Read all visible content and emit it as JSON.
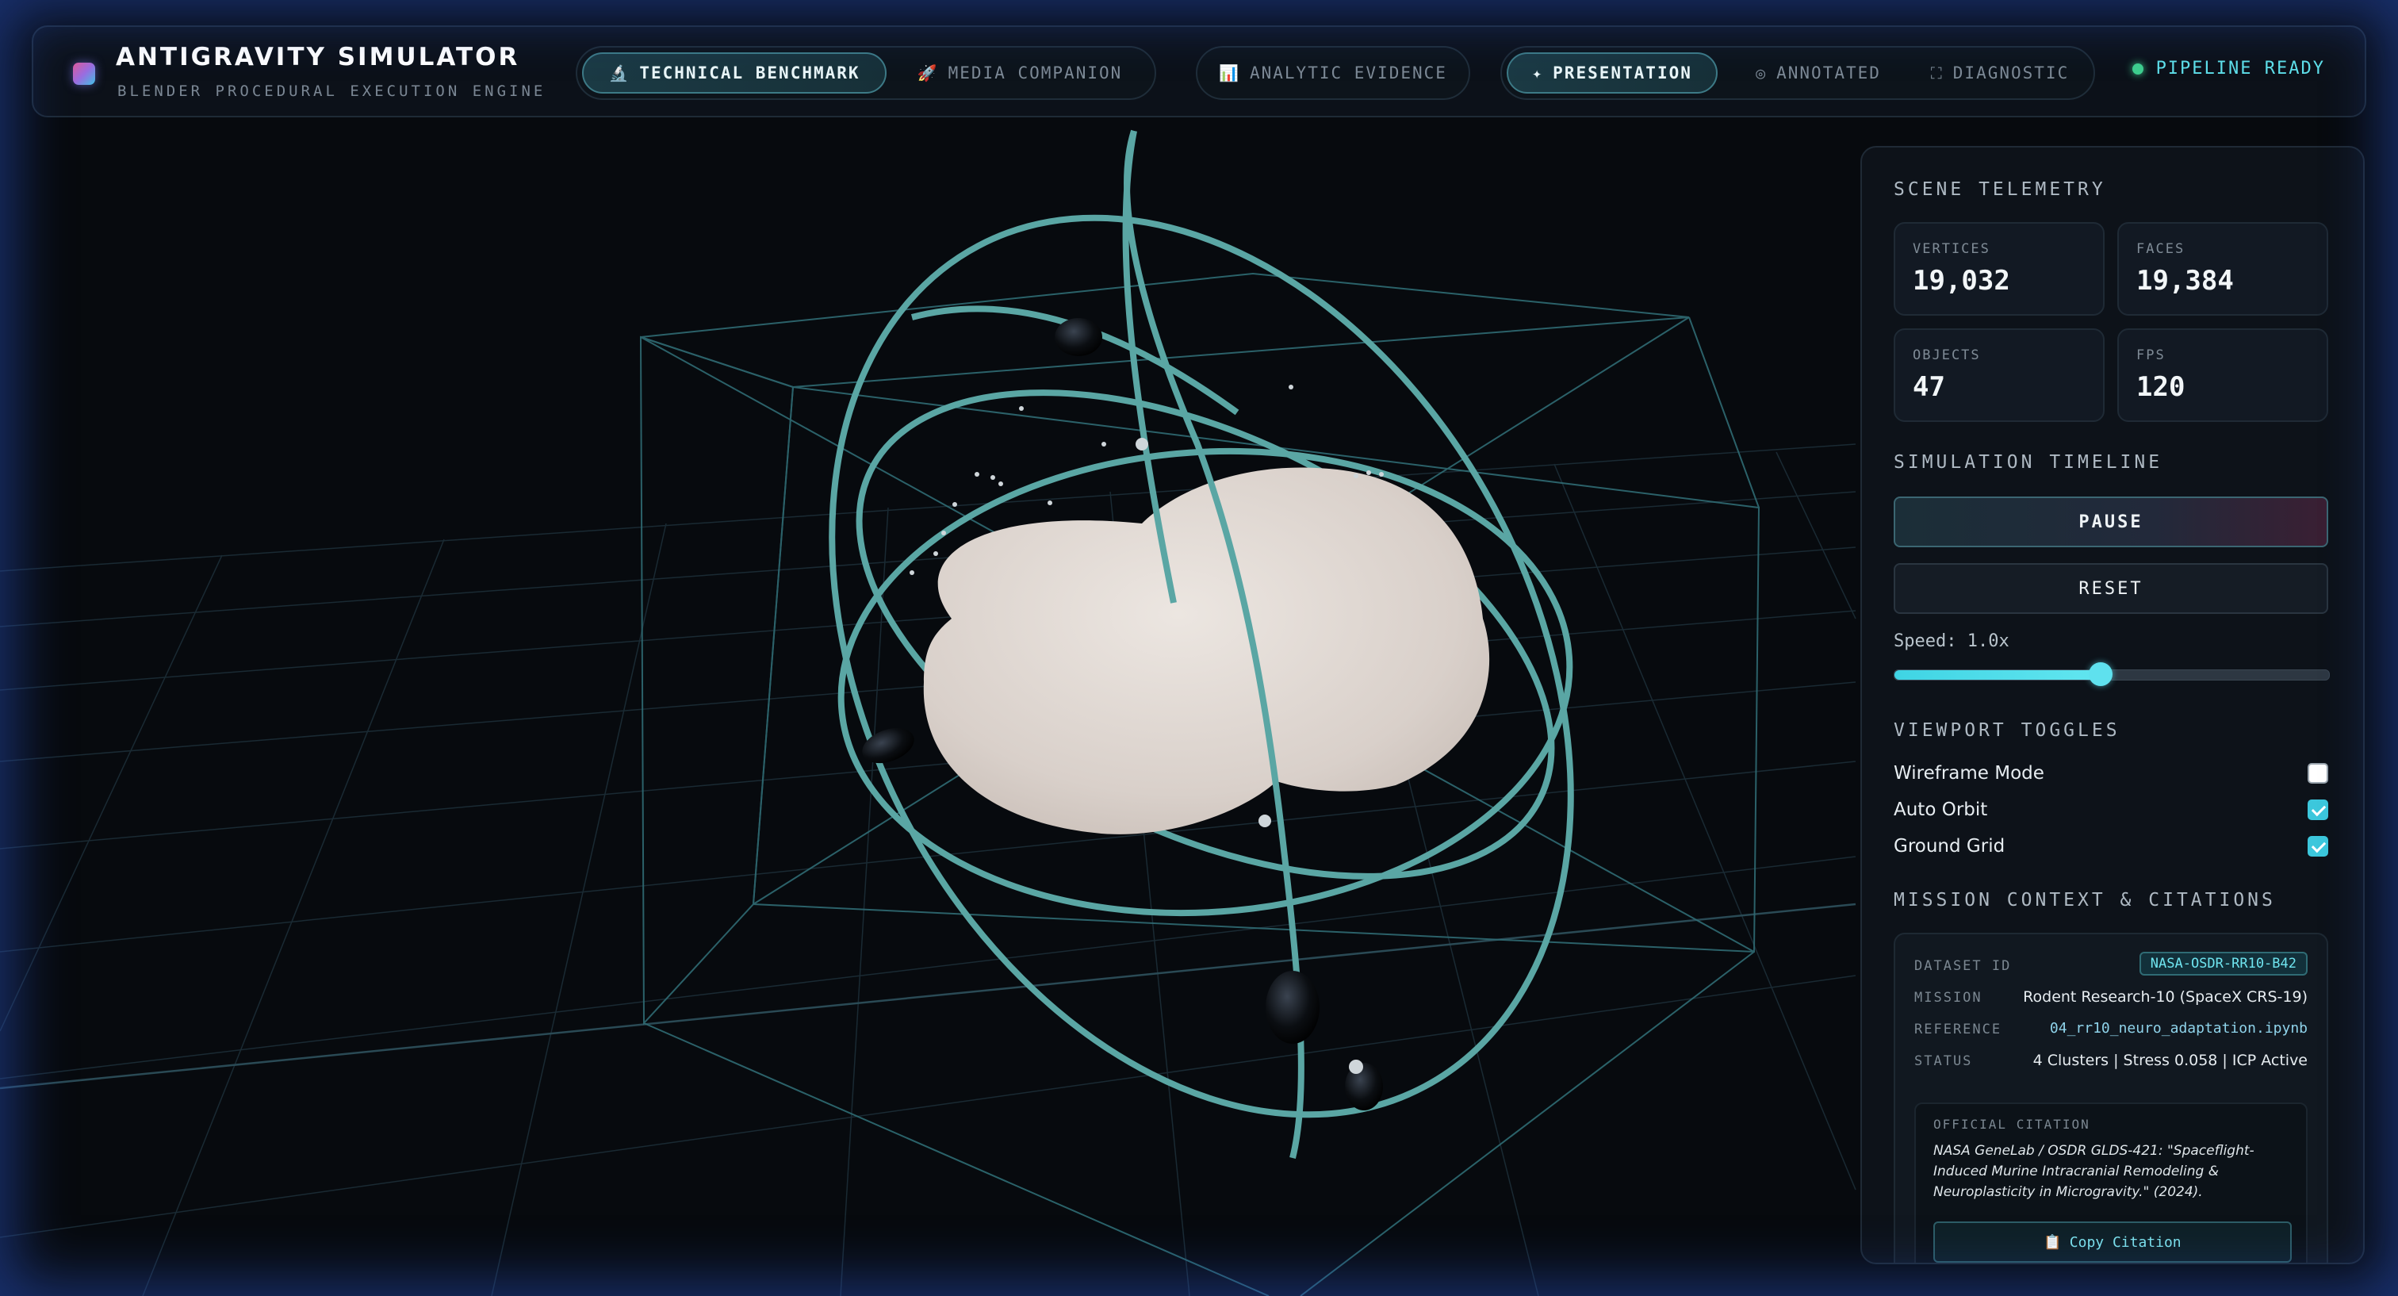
{
  "app": {
    "title": "ANTIGRAVITY SIMULATOR",
    "subtitle": "BLENDER PROCEDURAL EXECUTION ENGINE"
  },
  "nav": {
    "group1": [
      {
        "icon": "microscope-icon",
        "glyph": "🔬",
        "label": "TECHNICAL BENCHMARK",
        "active": true
      },
      {
        "icon": "rocket-icon",
        "glyph": "🚀",
        "label": "MEDIA COMPANION",
        "active": false
      }
    ],
    "group2": [
      {
        "icon": "bar-chart-icon",
        "glyph": "📊",
        "label": "ANALYTIC EVIDENCE",
        "active": false
      }
    ],
    "group3": [
      {
        "icon": "sparkle-icon",
        "glyph": "✦",
        "label": "PRESENTATION",
        "active": true
      },
      {
        "icon": "target-icon",
        "glyph": "◎",
        "label": "ANNOTATED",
        "active": false
      },
      {
        "icon": "frame-icon",
        "glyph": "⛶",
        "label": "DIAGNOSTIC",
        "active": false
      }
    ]
  },
  "status": {
    "label": "PIPELINE READY",
    "color": "#3ecf8e"
  },
  "telemetry": {
    "title": "SCENE TELEMETRY",
    "vertices_label": "VERTICES",
    "vertices": "19,032",
    "faces_label": "FACES",
    "faces": "19,384",
    "objects_label": "OBJECTS",
    "objects": "47",
    "fps_label": "FPS",
    "fps": "120"
  },
  "timeline": {
    "title": "SIMULATION TIMELINE",
    "pause_label": "PAUSE",
    "reset_label": "RESET",
    "speed_label": "Speed: 1.0x",
    "speed_fraction": 0.475
  },
  "toggles": {
    "title": "VIEWPORT TOGGLES",
    "items": [
      {
        "label": "Wireframe Mode",
        "checked": false
      },
      {
        "label": "Auto Orbit",
        "checked": true
      },
      {
        "label": "Ground Grid",
        "checked": true
      }
    ]
  },
  "context": {
    "title": "MISSION CONTEXT & CITATIONS",
    "dataset_label": "DATASET ID",
    "dataset": "NASA-OSDR-RR10-B42",
    "mission_label": "MISSION",
    "mission": "Rodent Research-10 (SpaceX CRS-19)",
    "reference_label": "REFERENCE",
    "reference": "04_rr10_neuro_adaptation.ipynb",
    "status_label": "STATUS",
    "status": "4 Clusters | Stress 0.058 | ICP Active",
    "citation_title": "OFFICIAL CITATION",
    "citation": "NASA GeneLab / OSDR GLDS-421: \"Spaceflight-Induced Murine Intracranial Remodeling & Neuroplasticity in Microgravity.\" (2024).",
    "copy_label": "Copy Citation"
  },
  "colors": {
    "accent": "#5fe1ee",
    "orbit": "#5aa6a4",
    "blob": "#ddd5cf"
  }
}
